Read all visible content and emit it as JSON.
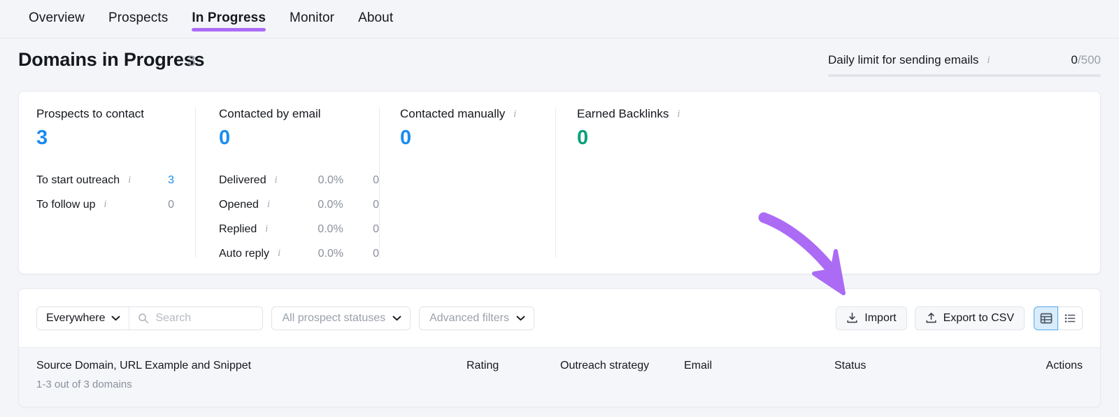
{
  "tabs": [
    {
      "label": "Overview",
      "active": false
    },
    {
      "label": "Prospects",
      "active": false
    },
    {
      "label": "In Progress",
      "active": true
    },
    {
      "label": "Monitor",
      "active": false
    },
    {
      "label": "About",
      "active": false
    }
  ],
  "header": {
    "title": "Domains in Progress",
    "count": "3",
    "daily_limit_label": "Daily limit for sending emails",
    "daily_limit_value": "0",
    "daily_limit_sep": "/",
    "daily_limit_max": "500",
    "daily_limit_percent": 0
  },
  "stats": {
    "prospects_to_contact": {
      "title": "Prospects to contact",
      "value": "3",
      "rows": [
        {
          "label": "To start outreach",
          "info": true,
          "value": "3",
          "accent": "blue"
        },
        {
          "label": "To follow up",
          "info": true,
          "value": "0",
          "accent": "gray"
        }
      ]
    },
    "contacted_by_email": {
      "title": "Contacted by email",
      "value": "0",
      "rows": [
        {
          "label": "Delivered",
          "info": true,
          "pct": "0.0%",
          "value": "0"
        },
        {
          "label": "Opened",
          "info": true,
          "pct": "0.0%",
          "value": "0"
        },
        {
          "label": "Replied",
          "info": true,
          "pct": "0.0%",
          "value": "0"
        },
        {
          "label": "Auto reply",
          "info": true,
          "pct": "0.0%",
          "value": "0"
        }
      ]
    },
    "contacted_manually": {
      "title": "Contacted manually",
      "info": true,
      "value": "0"
    },
    "earned_backlinks": {
      "title": "Earned Backlinks",
      "info": true,
      "value": "0"
    }
  },
  "toolbar": {
    "scope_select": "Everywhere",
    "search_placeholder": "Search",
    "search_value": "",
    "status_filter": "All prospect statuses",
    "advanced_filters": "Advanced filters",
    "import_label": "Import",
    "export_label": "Export to CSV",
    "view_table_active": true
  },
  "table": {
    "col_main": "Source Domain, URL Example and Snippet",
    "col_main_sub": "1-3 out of 3 domains",
    "col_rating": "Rating",
    "col_outreach": "Outreach strategy",
    "col_email": "Email",
    "col_status": "Status",
    "col_actions": "Actions"
  },
  "colors": {
    "accent_purple": "#ab6bf5",
    "blue": "#1a8cf0",
    "green": "#06a17a",
    "page_bg": "#f4f5f8"
  }
}
